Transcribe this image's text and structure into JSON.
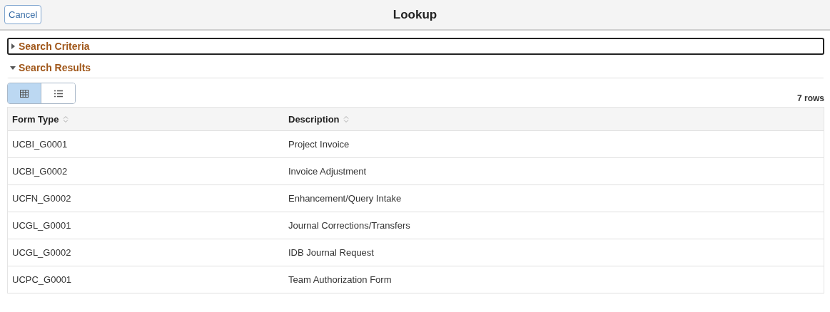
{
  "header": {
    "cancel": "Cancel",
    "title": "Lookup"
  },
  "sections": [
    {
      "label": "Search Criteria",
      "expanded": false,
      "focused": true
    },
    {
      "label": "Search Results",
      "expanded": true,
      "focused": false
    }
  ],
  "view_toggle": [
    {
      "kind": "grid",
      "selected": true
    },
    {
      "kind": "list",
      "selected": false
    }
  ],
  "row_count": "7 rows",
  "table": {
    "columns": [
      "Form Type",
      "Description"
    ],
    "rows": [
      [
        "UCBI_G0001",
        "Project Invoice"
      ],
      [
        "UCBI_G0002",
        "Invoice Adjustment"
      ],
      [
        "UCFN_G0002",
        "Enhancement/Query Intake"
      ],
      [
        "UCGL_G0001",
        "Journal Corrections/Transfers"
      ],
      [
        "UCGL_G0002",
        "IDB Journal Request"
      ],
      [
        "UCPC_G0001",
        "Team Authorization Form"
      ]
    ]
  }
}
